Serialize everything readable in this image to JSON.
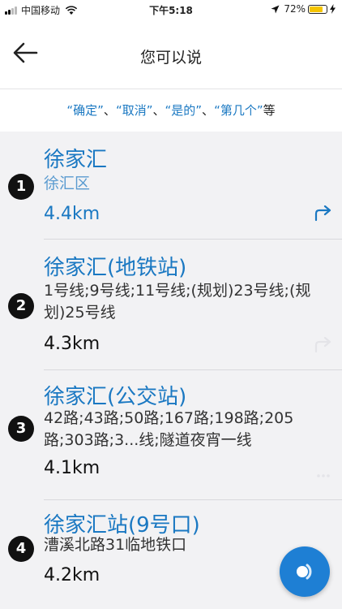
{
  "status_bar": {
    "carrier": "中国移动",
    "time": "下午5:18",
    "battery": "72%",
    "battery_level": 0.72
  },
  "header": {
    "title": "您可以说",
    "back_icon": "arrow-left-icon"
  },
  "hint": {
    "keywords": [
      "“确定”",
      "“取消”",
      "“是的”",
      "“第几个”"
    ],
    "separator": "、",
    "suffix": "等"
  },
  "results": [
    {
      "index": "1",
      "name": "徐家汇",
      "detail": "徐汇区",
      "distance": "4.4km",
      "highlight": true
    },
    {
      "index": "2",
      "name": "徐家汇(地铁站)",
      "detail": "1号线;9号线;11号线;(规划)23号线;(规划)25号线",
      "distance": "4.3km",
      "highlight": false
    },
    {
      "index": "3",
      "name": "徐家汇(公交站)",
      "detail": "42路;43路;50路;167路;198路;205路;303路;3...线;隧道夜宵一线",
      "distance": "4.1km",
      "highlight": false
    },
    {
      "index": "4",
      "name": "徐家汇站(9号口)",
      "detail": "漕溪北路31临地铁口",
      "distance": "4.2km",
      "highlight": false
    }
  ],
  "colors": {
    "accent": "#1a78c2",
    "voice_button": "#1e7fd4"
  },
  "voice_button_icon": "voice-assistant-icon"
}
